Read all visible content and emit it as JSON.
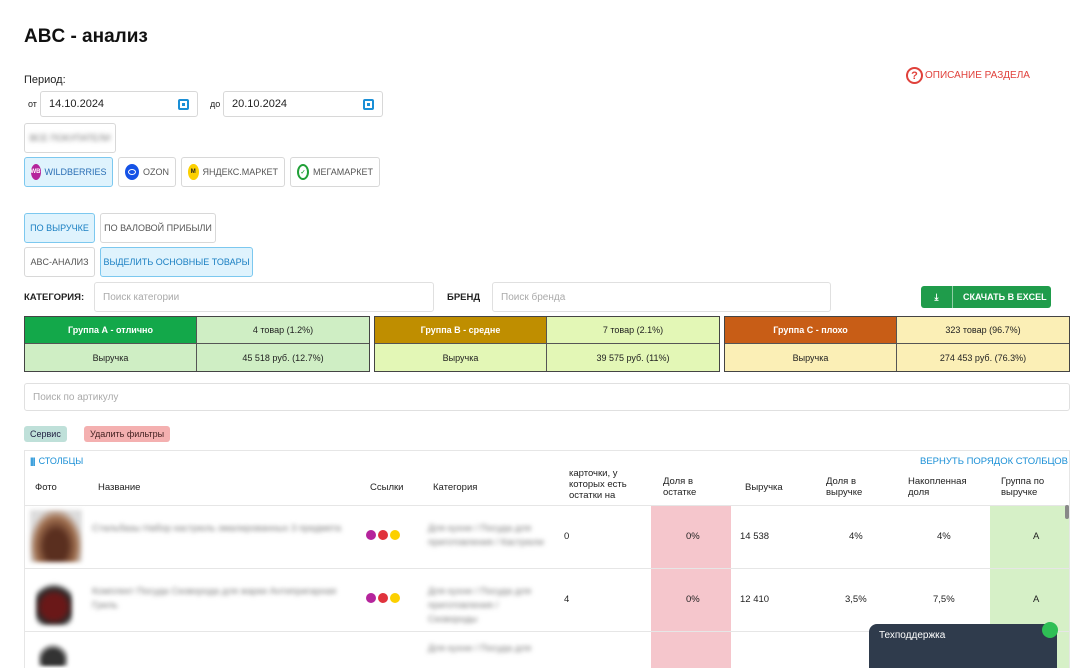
{
  "page_title": "ABC - анализ",
  "period": {
    "label": "Период:",
    "from_label": "от",
    "from_value": "14.10.2024",
    "to_label": "до",
    "to_value": "20.10.2024"
  },
  "help_link": "ОПИСАНИЕ РАЗДЕЛА",
  "account_chip": "ВСЕ ПОКУПАТЕЛИ",
  "marketplaces": [
    {
      "label": "WILDBERRIES",
      "logo": "WB",
      "active": true
    },
    {
      "label": "OZON",
      "logo": "",
      "active": false
    },
    {
      "label": "ЯНДЕКС.МАРКЕТ",
      "logo": "",
      "active": false
    },
    {
      "label": "МЕГАМАРКЕТ",
      "logo": "",
      "active": false
    }
  ],
  "mode_buttons": {
    "revenue": "ПО ВЫРУЧКЕ",
    "gross_profit": "ПО ВАЛОВОЙ ПРИБЫЛИ"
  },
  "view_buttons": {
    "abc": "ABC-АНАЛИЗ",
    "highlight": "ВЫДЕЛИТЬ ОСНОВНЫЕ ТОВАРЫ"
  },
  "filters": {
    "category_label": "КАТЕГОРИЯ:",
    "category_placeholder": "Поиск категории",
    "brand_label": "БРЕНД",
    "brand_placeholder": "Поиск бренда"
  },
  "excel_button": "СКАЧАТЬ В EXCEL",
  "groups": [
    {
      "title": "Группа А - отлично",
      "count": "4 товар (1.2%)",
      "metric": "Выручка",
      "value": "45 518 руб. (12.7%)"
    },
    {
      "title": "Группа B - средне",
      "count": "7 товар (2.1%)",
      "metric": "Выручка",
      "value": "39 575 руб. (11%)"
    },
    {
      "title": "Группа C - плохо",
      "count": "323 товар (96.7%)",
      "metric": "Выручка",
      "value": "274 453 руб. (76.3%)"
    }
  ],
  "article_search_placeholder": "Поиск по артикулу",
  "tags": {
    "service": "Сервис",
    "clear_filters": "Удалить фильтры"
  },
  "columns_toggle": "СТОЛБЦЫ",
  "reset_columns": "ВЕРНУТЬ ПОРЯДОК СТОЛБЦОВ",
  "table": {
    "headers": {
      "photo": "Фото",
      "name": "Название",
      "links": "Ссылки",
      "category": "Категория",
      "stock_cards": "карточки, у которых есть остатки на",
      "stock_share": "Доля в остатке",
      "revenue": "Выручка",
      "revenue_share": "Доля в выручке",
      "cumulative": "Накопленная доля",
      "group": "Группа по выручке"
    },
    "rows": [
      {
        "name": "Стальбазы Набор кастрюль эмалированных 3 предмета",
        "category": "Для кухни / Посуда для приготовления / Кастрюли",
        "stock": "0",
        "stock_share": "0%",
        "revenue": "14 538",
        "revenue_share": "4%",
        "cumulative": "4%",
        "group": "A"
      },
      {
        "name": "Комплект Посуда Сковорода для жарки Антипригарная Гриль",
        "category": "Для кухни / Посуда для приготовления / Сковороды",
        "stock": "4",
        "stock_share": "0%",
        "revenue": "12 410",
        "revenue_share": "3,5%",
        "cumulative": "7,5%",
        "group": "A"
      },
      {
        "name": "",
        "category": "Для кухни / Посуда для",
        "stock": "",
        "stock_share": "",
        "revenue": "",
        "revenue_share": "",
        "cumulative": "",
        "group": ""
      }
    ]
  },
  "support_widget": "Техподдержка",
  "colors": {
    "group_a_header": "#13a84a",
    "group_a_cell": "#cfeec4",
    "group_b_header": "#bf8e00",
    "group_b_cell": "#e3f7b6",
    "group_c_header": "#c85d16",
    "group_c_cell": "#fbefb6",
    "stock_share_bg": "#f5c6cc",
    "group_col_bg": "#d6f0c7",
    "accent": "#1a8fd6",
    "excel": "#1f9c4b"
  }
}
